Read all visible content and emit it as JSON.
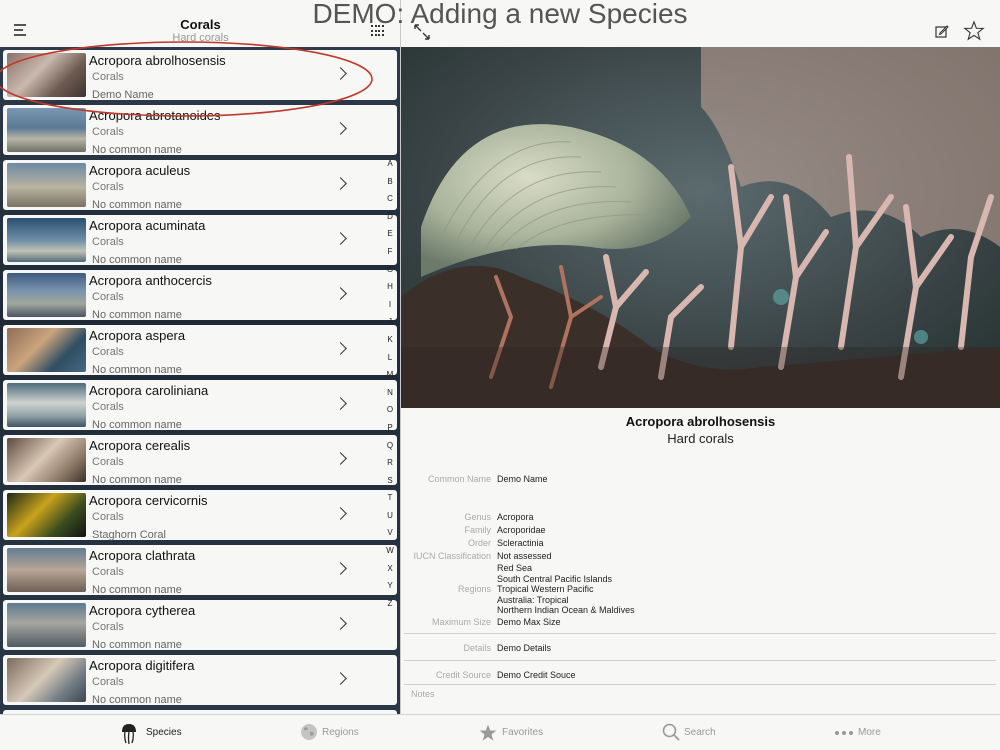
{
  "banner": "DEMO: Adding a new Species",
  "master": {
    "title": "Corals",
    "subtitle": "Hard corals",
    "alpha_index": [
      "A",
      "B",
      "C",
      "D",
      "E",
      "F",
      "G",
      "H",
      "I",
      "J",
      "K",
      "L",
      "M",
      "N",
      "O",
      "P",
      "Q",
      "R",
      "S",
      "T",
      "U",
      "V",
      "W",
      "X",
      "Y",
      "Z"
    ],
    "items": [
      {
        "name": "Acropora abrolhosensis",
        "group": "Corals",
        "common": "Demo Name"
      },
      {
        "name": "Acropora abrotanoides",
        "group": "Corals",
        "common": "No common name"
      },
      {
        "name": "Acropora aculeus",
        "group": "Corals",
        "common": "No common name"
      },
      {
        "name": "Acropora acuminata",
        "group": "Corals",
        "common": "No common name"
      },
      {
        "name": "Acropora anthocercis",
        "group": "Corals",
        "common": "No common name"
      },
      {
        "name": "Acropora aspera",
        "group": "Corals",
        "common": "No common name"
      },
      {
        "name": "Acropora caroliniana",
        "group": "Corals",
        "common": "No common name"
      },
      {
        "name": "Acropora cerealis",
        "group": "Corals",
        "common": "No common name"
      },
      {
        "name": "Acropora cervicornis",
        "group": "Corals",
        "common": "Staghorn Coral"
      },
      {
        "name": "Acropora clathrata",
        "group": "Corals",
        "common": "No common name"
      },
      {
        "name": "Acropora cytherea",
        "group": "Corals",
        "common": "No common name"
      },
      {
        "name": "Acropora digitifera",
        "group": "Corals",
        "common": "No common name"
      }
    ]
  },
  "detail": {
    "name": "Acropora abrolhosensis",
    "group": "Hard corals",
    "common_name_label": "Common Name",
    "common_name": "Demo Name",
    "genus_label": "Genus",
    "genus": "Acropora",
    "family_label": "Family",
    "family": "Acroporidae",
    "order_label": "Order",
    "order": "Scleractinia",
    "iucn_label": "IUCN Classification",
    "iucn": "Not assessed",
    "regions_label": "Regions",
    "regions": [
      "Red Sea",
      "South Central Pacific Islands",
      "Tropical Western Pacific",
      "Australia: Tropical",
      "Northern Indian Ocean & Maldives"
    ],
    "max_size_label": "Maximum Size",
    "max_size": "Demo Max Size",
    "details_label": "Details",
    "details": "Demo Details",
    "credit_label": "Credit Source",
    "credit": "Demo Credit Souce",
    "notes_label": "Notes"
  },
  "tabs": [
    {
      "label": "Species",
      "icon": "jellyfish-icon",
      "active": true
    },
    {
      "label": "Regions",
      "icon": "globe-icon",
      "active": false
    },
    {
      "label": "Favorites",
      "icon": "star-icon",
      "active": false
    },
    {
      "label": "Search",
      "icon": "search-icon",
      "active": false
    },
    {
      "label": "More",
      "icon": "more-dots-icon",
      "active": false
    }
  ],
  "colors": {
    "highlight_ellipse": "#c0392b",
    "tab_active": "#222222",
    "tab_inactive": "#9a9a9a"
  }
}
